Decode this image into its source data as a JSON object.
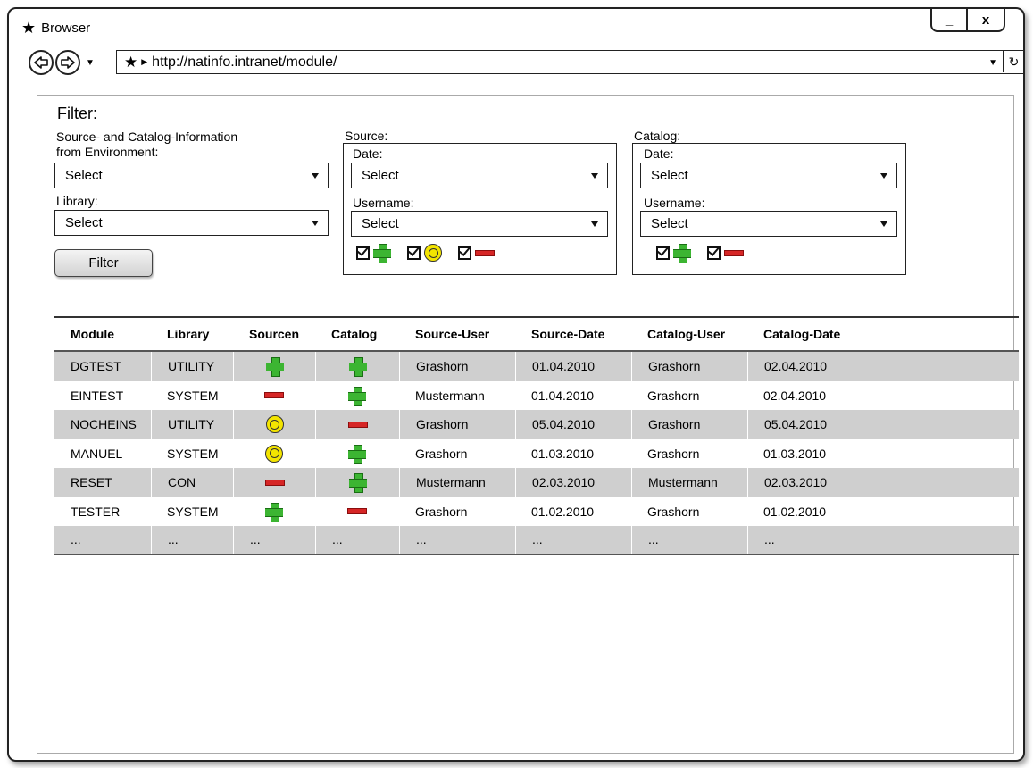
{
  "window": {
    "title": "Browser",
    "minimize": "_",
    "close": "x"
  },
  "nav": {
    "url": "http://natinfo.intranet/module/"
  },
  "filter": {
    "title": "Filter:",
    "env_label_line1": "Source- and Catalog-Information",
    "env_label_line2": "from Environment:",
    "env_select": "Select",
    "library_label": "Library:",
    "library_select": "Select",
    "button": "Filter"
  },
  "source": {
    "title": "Source:",
    "date_label": "Date:",
    "date_select": "Select",
    "username_label": "Username:",
    "username_select": "Select"
  },
  "catalog": {
    "title": "Catalog:",
    "date_label": "Date:",
    "date_select": "Select",
    "username_label": "Username:",
    "username_select": "Select"
  },
  "table": {
    "headers": [
      "Module",
      "Library",
      "Sourcen",
      "Catalog",
      "Source-User",
      "Source-Date",
      "Catalog-User",
      "Catalog-Date"
    ],
    "rows": [
      {
        "module": "DGTEST",
        "library": "UTILITY",
        "source": "plus",
        "catalog": "plus",
        "source_user": "Grashorn",
        "source_date": "01.04.2010",
        "catalog_user": "Grashorn",
        "catalog_date": "02.04.2010"
      },
      {
        "module": "EINTEST",
        "library": "SYSTEM",
        "source": "minus",
        "catalog": "plus",
        "source_user": "Mustermann",
        "source_date": "01.04.2010",
        "catalog_user": "Grashorn",
        "catalog_date": "02.04.2010"
      },
      {
        "module": "NOCHEINS",
        "library": "UTILITY",
        "source": "ring",
        "catalog": "minus",
        "source_user": "Grashorn",
        "source_date": "05.04.2010",
        "catalog_user": "Grashorn",
        "catalog_date": "05.04.2010"
      },
      {
        "module": "MANUEL",
        "library": "SYSTEM",
        "source": "ring",
        "catalog": "plus",
        "source_user": "Grashorn",
        "source_date": "01.03.2010",
        "catalog_user": "Grashorn",
        "catalog_date": "01.03.2010"
      },
      {
        "module": "RESET",
        "library": "CON",
        "source": "minus",
        "catalog": "plus",
        "source_user": "Mustermann",
        "source_date": "02.03.2010",
        "catalog_user": "Mustermann",
        "catalog_date": "02.03.2010"
      },
      {
        "module": "TESTER",
        "library": "SYSTEM",
        "source": "plus",
        "catalog": "minus",
        "source_user": "Grashorn",
        "source_date": "01.02.2010",
        "catalog_user": "Grashorn",
        "catalog_date": "01.02.2010"
      }
    ],
    "ellipsis": "..."
  },
  "colors": {
    "plus": "#3cb532",
    "minus": "#d62626",
    "ring": "#f3e400",
    "row_shade": "#cfcfcf"
  }
}
